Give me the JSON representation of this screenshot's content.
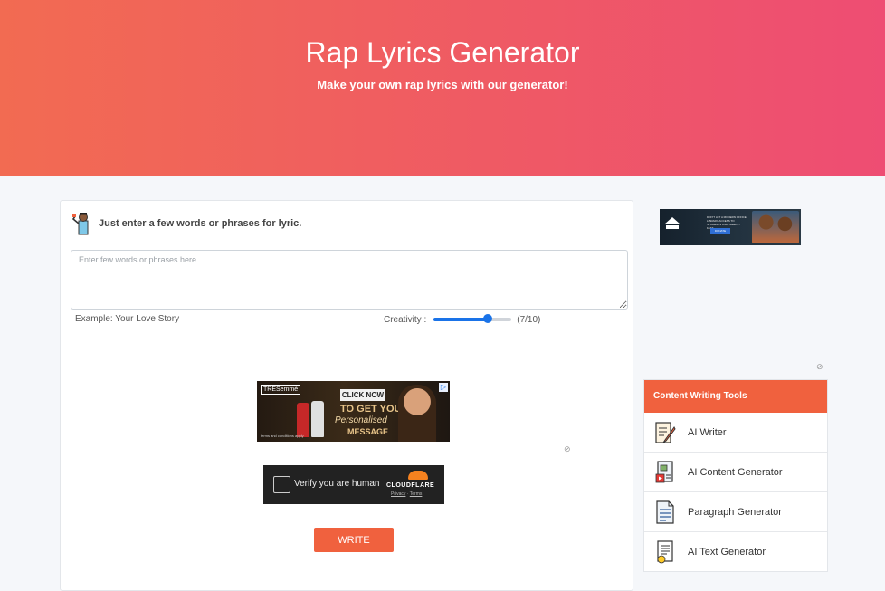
{
  "hero": {
    "title": "Rap Lyrics Generator",
    "subtitle": "Make your own rap lyrics with our generator!"
  },
  "form": {
    "intro": "Just enter a few words or phrases for lyric.",
    "input_placeholder": "Enter few words or phrases here",
    "input_value": "",
    "example": "Example: Your Love Story",
    "creativity_label": "Creativity :",
    "creativity_value": 7,
    "creativity_max": 10,
    "creativity_display": "(7/10)",
    "write_button": "WRITE"
  },
  "ad_main": {
    "brand": "TRESemmé",
    "cta": "CLICK NOW",
    "line1": "TO GET YOUR",
    "line2": "Personalised",
    "line3": "MESSAGE",
    "fine_print": "terms and conditions apply"
  },
  "captcha": {
    "label": "Verify you are human",
    "brand": "CLOUDFLARE",
    "privacy": "Privacy",
    "separator": "·",
    "terms": "Terms"
  },
  "ad_side": {
    "text": "DON'T LET A MODERN OFFICE LIBRARY ACCESS TO STUDENTS WHO NEED IT FAST",
    "button": "DONATE"
  },
  "sidebar": {
    "title": "Content Writing Tools",
    "items": [
      {
        "label": "AI Writer",
        "icon": "pen-paper-icon"
      },
      {
        "label": "AI Content Generator",
        "icon": "document-media-icon"
      },
      {
        "label": "Paragraph Generator",
        "icon": "paragraph-document-icon"
      },
      {
        "label": "AI Text Generator",
        "icon": "text-document-icon"
      }
    ]
  },
  "colors": {
    "hero_start": "#f26b52",
    "hero_end": "#ee4d73",
    "accent": "#f0613e",
    "slider": "#1a73e8"
  }
}
